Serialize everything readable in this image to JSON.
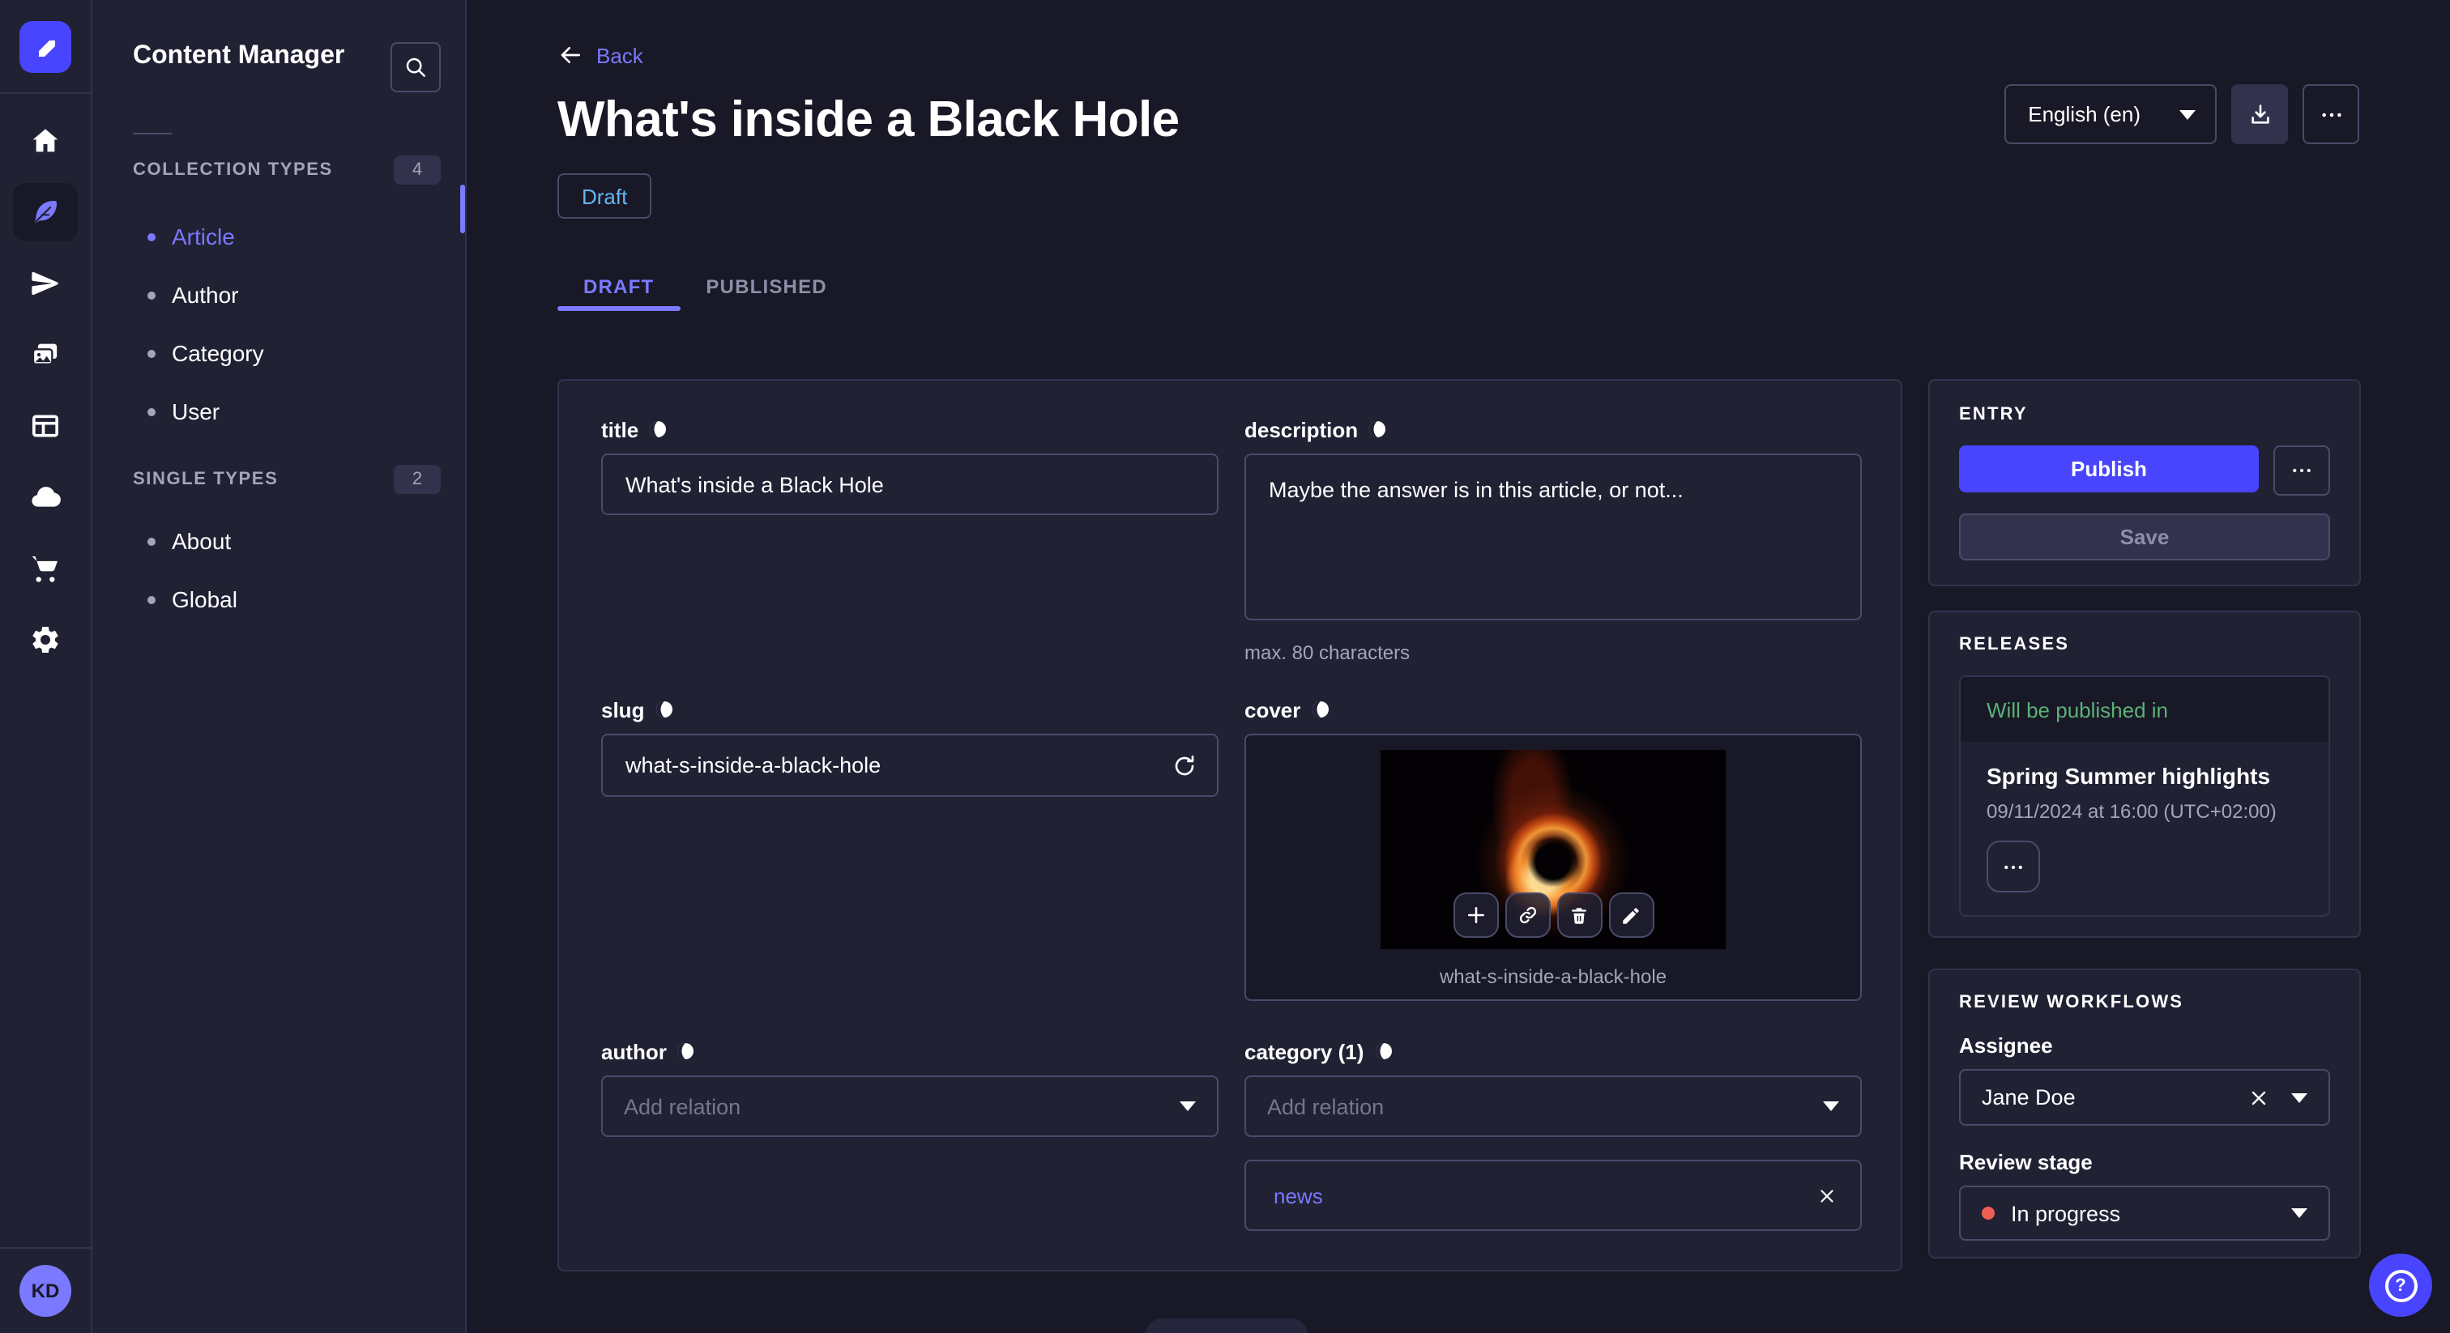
{
  "colors": {
    "accent": "#4945ff",
    "link_purple": "#7b79ff",
    "success_green": "#5cb176",
    "danger_red": "#ee5e52",
    "draft_blue": "#66b7f1",
    "panel_bg": "#212134",
    "page_bg": "#181826"
  },
  "glyphs": {
    "help": "?"
  },
  "rail": {
    "icons": [
      "strapi-logo-icon",
      "home-icon",
      "feather-icon",
      "send-icon",
      "media-icon",
      "layout-icon",
      "cloud-icon",
      "cart-icon",
      "gear-icon"
    ],
    "active_icon": "feather-icon",
    "avatar_initials": "KD"
  },
  "subnav": {
    "title": "Content Manager",
    "sections": [
      {
        "label": "COLLECTION TYPES",
        "count": "4",
        "items": [
          {
            "label": "Article"
          },
          {
            "label": "Author"
          },
          {
            "label": "Category"
          },
          {
            "label": "User"
          }
        ]
      },
      {
        "label": "SINGLE TYPES",
        "count": "2",
        "items": [
          {
            "label": "About"
          },
          {
            "label": "Global"
          }
        ]
      }
    ]
  },
  "header": {
    "back_label": "Back",
    "title": "What's inside a Black Hole",
    "status_badge": "Draft",
    "tabs": [
      {
        "label": "DRAFT"
      },
      {
        "label": "PUBLISHED"
      }
    ],
    "locale_selector": "English (en)"
  },
  "form": {
    "title": {
      "label": "title",
      "value": "What's inside a Black Hole"
    },
    "description": {
      "label": "description",
      "value": "Maybe the answer is in this article, or not...",
      "hint": "max. 80 characters"
    },
    "slug": {
      "label": "slug",
      "value": "what-s-inside-a-black-hole"
    },
    "cover": {
      "label": "cover",
      "caption": "what-s-inside-a-black-hole"
    },
    "author": {
      "label": "author",
      "placeholder": "Add relation"
    },
    "category": {
      "label": "category (1)",
      "placeholder": "Add relation",
      "relations": [
        {
          "label": "news"
        }
      ]
    }
  },
  "entry_panel": {
    "title": "ENTRY",
    "publish_label": "Publish",
    "save_label": "Save"
  },
  "releases_panel": {
    "title": "RELEASES",
    "card_header": "Will be published in",
    "release_name": "Spring Summer highlights",
    "release_date": "09/11/2024 at 16:00 (UTC+02:00)"
  },
  "review_panel": {
    "title": "REVIEW WORKFLOWS",
    "assignee_label": "Assignee",
    "assignee_value": "Jane Doe",
    "stage_label": "Review stage",
    "stage_value": "In progress"
  }
}
